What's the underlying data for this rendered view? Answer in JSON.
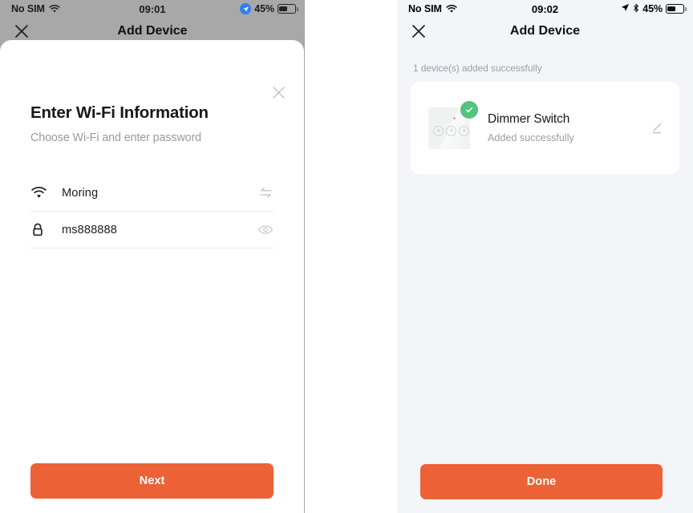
{
  "theme": {
    "accent": "#ec6136",
    "success_green": "#52c47d",
    "dim_backdrop": "#a8a8a8",
    "page_bg_right": "#f4f5f8",
    "muted_text": "#9b9ca2"
  },
  "left_phone": {
    "status_bar": {
      "carrier": "No SIM",
      "wifi_icon": "wifi-icon",
      "time": "09:01",
      "location_icon": "location-arrow-icon",
      "battery_percent": "45%",
      "battery_icon": "battery-icon"
    },
    "nav_bar": {
      "close_icon": "close-icon",
      "title": "Add Device"
    },
    "sheet": {
      "close_icon": "close-icon",
      "title": "Enter Wi-Fi Information",
      "subtitle": "Choose Wi-Fi and enter password",
      "fields": [
        {
          "icon": "wifi-icon",
          "value": "Moring",
          "placeholder": "Wi-Fi name",
          "action_icon": "switch-network-icon"
        },
        {
          "icon": "lock-icon",
          "value": "ms888888",
          "placeholder": "Password",
          "action_icon": "eye-icon"
        }
      ],
      "primary_button": "Next"
    }
  },
  "right_phone": {
    "status_bar": {
      "carrier": "No SIM",
      "wifi_icon": "wifi-icon",
      "time": "09:02",
      "location_icon": "location-arrow-icon",
      "bluetooth_icon": "bluetooth-icon",
      "battery_percent": "45%",
      "battery_icon": "battery-icon"
    },
    "nav_bar": {
      "close_icon": "close-icon",
      "title": "Add Device"
    },
    "result": {
      "summary": "1 device(s) added successfully",
      "devices": [
        {
          "thumbnail": "dimmer-switch-thumbnail",
          "badge_icon": "check-icon",
          "name": "Dimmer Switch",
          "status": "Added successfully",
          "edit_icon": "edit-pencil-icon"
        }
      ],
      "primary_button": "Done"
    }
  }
}
